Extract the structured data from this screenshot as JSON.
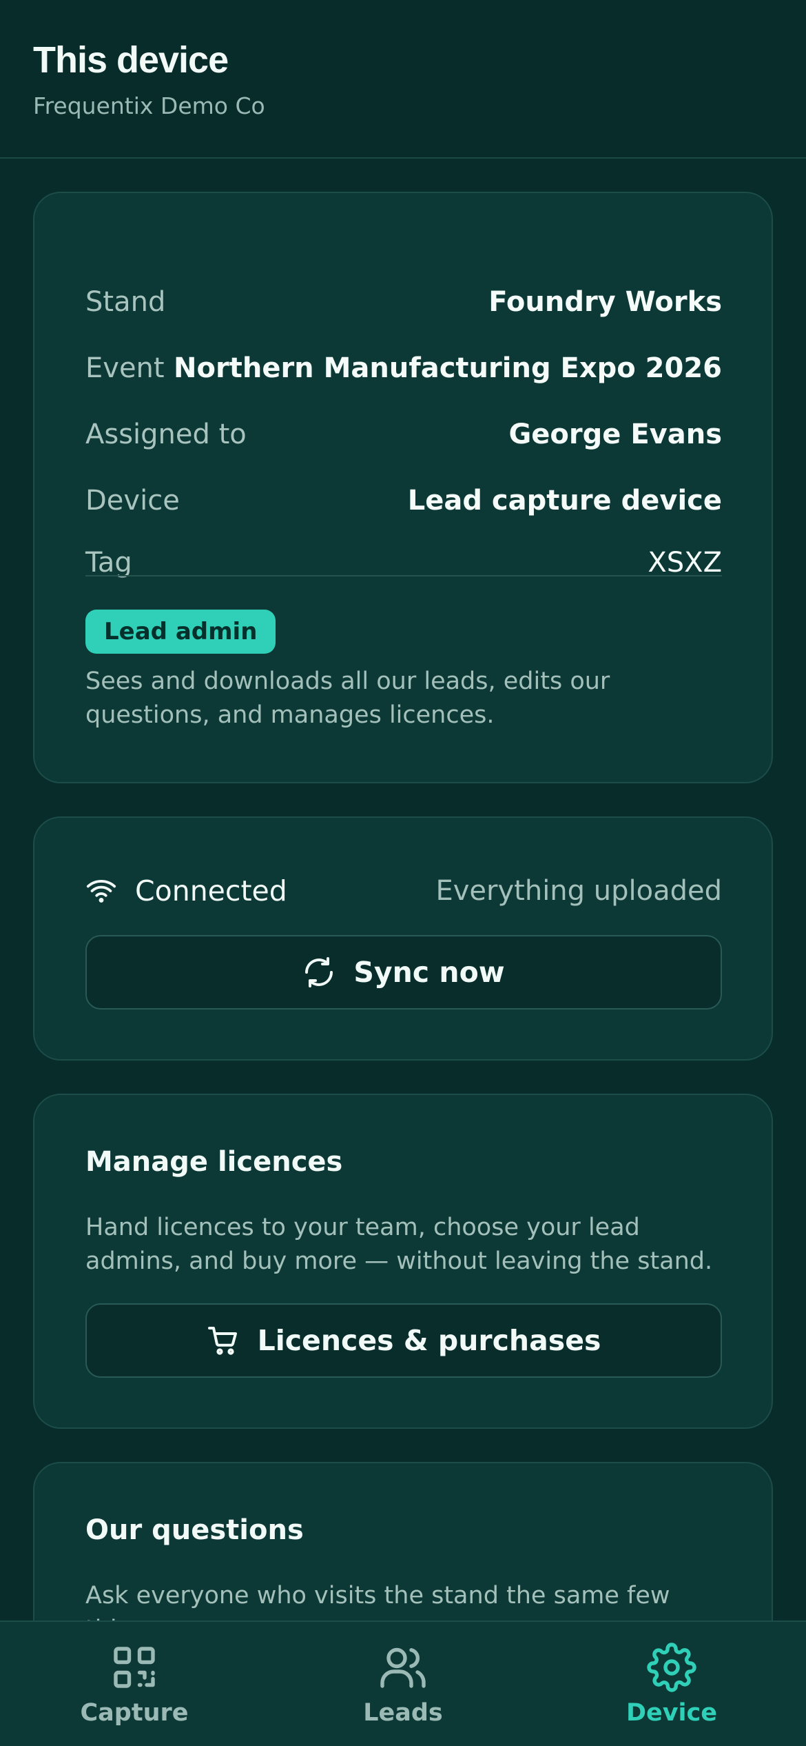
{
  "header": {
    "title": "This device",
    "subtitle": "Frequentix Demo Co"
  },
  "info": {
    "rows": [
      {
        "label": "Stand",
        "value": "Foundry Works"
      },
      {
        "label": "Event",
        "value": "Northern Manufacturing Expo 2026"
      },
      {
        "label": "Assigned to",
        "value": "George Evans"
      },
      {
        "label": "Device",
        "value": "Lead capture device"
      },
      {
        "label": "Tag",
        "value": "XSXZ"
      }
    ],
    "role_badge": "Lead admin",
    "role_description": "Sees and downloads all our leads, edits our questions, and manages licences."
  },
  "sync": {
    "status_icon": "wifi-icon",
    "status": "Connected",
    "upload_status": "Everything uploaded",
    "button_icon": "refresh-icon",
    "button_label": "Sync now"
  },
  "licences": {
    "title": "Manage licences",
    "description": "Hand licences to your team, choose your lead admins, and buy more — without leaving the stand.",
    "button_icon": "cart-icon",
    "button_label": "Licences & purchases"
  },
  "questions": {
    "title": "Our questions",
    "description": "Ask everyone who visits the stand the same few things,"
  },
  "nav": {
    "items": [
      {
        "label": "Capture",
        "icon": "qr-code-icon",
        "active": false
      },
      {
        "label": "Leads",
        "icon": "users-icon",
        "active": false
      },
      {
        "label": "Device",
        "icon": "gear-icon",
        "active": true
      }
    ]
  },
  "colors": {
    "background": "#072c2a",
    "card": "#0c3835",
    "accent": "#2fd0b7",
    "muted_text": "#a3c0bb"
  }
}
